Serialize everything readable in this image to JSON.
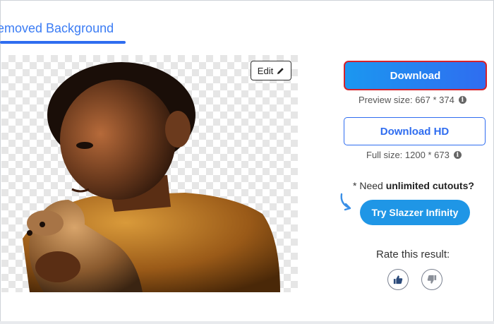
{
  "tab": {
    "label": "emoved Background"
  },
  "preview": {
    "edit_label": "Edit"
  },
  "download": {
    "primary_label": "Download",
    "preview_size": "Preview size: 667 * 374",
    "hd_label": "Download HD",
    "full_size": "Full size: 1200 * 673"
  },
  "promo": {
    "prefix": "* Need ",
    "highlight": "unlimited cutouts?",
    "button_label": "Try Slazzer Infinity"
  },
  "rating": {
    "label": "Rate this result:"
  },
  "colors": {
    "accent": "#2f6df0",
    "highlight_border": "#d6222a",
    "pill": "#1f96e6"
  },
  "icons": [
    "pencil-icon",
    "info-icon",
    "curved-arrow-icon",
    "thumbs-up-icon",
    "thumbs-down-icon"
  ]
}
